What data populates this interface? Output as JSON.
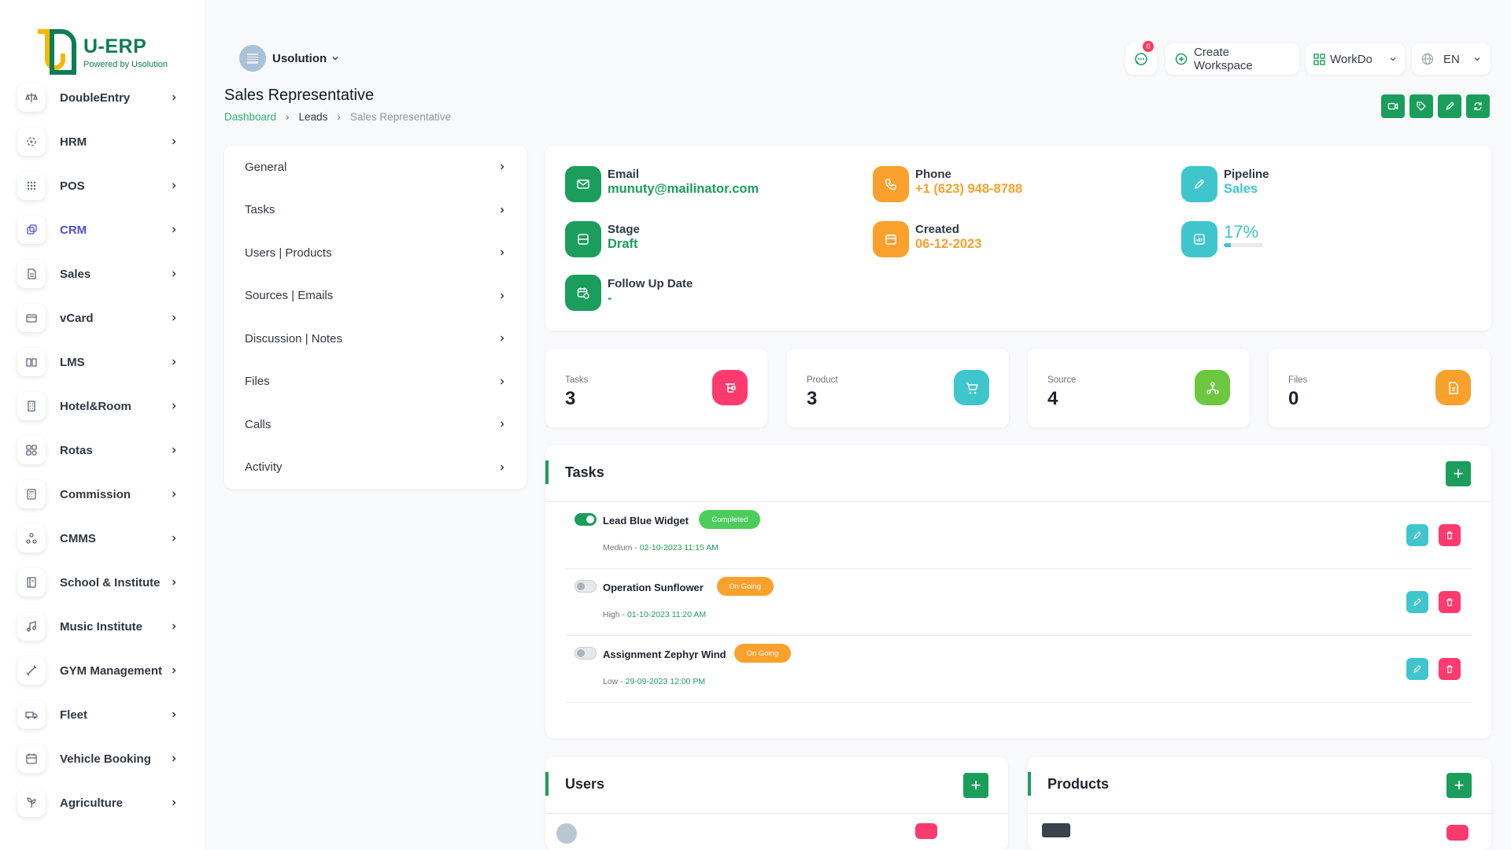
{
  "logo": {
    "name": "U-ERP",
    "sub": "Powered by Usolution"
  },
  "sidebar": {
    "items": [
      {
        "label": "DoubleEntry",
        "icon": "scale-icon"
      },
      {
        "label": "HRM",
        "icon": "hrm-icon"
      },
      {
        "label": "POS",
        "icon": "grid-icon"
      },
      {
        "label": "CRM",
        "icon": "crm-icon",
        "active": true
      },
      {
        "label": "Sales",
        "icon": "document-icon"
      },
      {
        "label": "vCard",
        "icon": "card-icon"
      },
      {
        "label": "LMS",
        "icon": "book-icon"
      },
      {
        "label": "Hotel&Room",
        "icon": "building-icon"
      },
      {
        "label": "Rotas",
        "icon": "apps-icon"
      },
      {
        "label": "Commission",
        "icon": "calculator-icon"
      },
      {
        "label": "CMMS",
        "icon": "nodes-icon"
      },
      {
        "label": "School & Institute",
        "icon": "school-icon"
      },
      {
        "label": "Music Institute",
        "icon": "music-icon"
      },
      {
        "label": "GYM Management",
        "icon": "dumbbell-icon"
      },
      {
        "label": "Fleet",
        "icon": "truck-icon"
      },
      {
        "label": "Vehicle Booking",
        "icon": "calendar-icon"
      },
      {
        "label": "Agriculture",
        "icon": "plant-icon"
      }
    ]
  },
  "header": {
    "workspace": "Usolution",
    "notifications_count": "0",
    "create_workspace": "Create Workspace",
    "workdo": "WorkDo",
    "language": "EN"
  },
  "page": {
    "title": "Sales Representative",
    "breadcrumb": [
      "Dashboard",
      "Leads",
      "Sales Representative"
    ]
  },
  "menu": [
    "General",
    "Tasks",
    "Users | Products",
    "Sources | Emails",
    "Discussion | Notes",
    "Files",
    "Calls",
    "Activity"
  ],
  "info": {
    "email_label": "Email",
    "email": "munuty@mailinator.com",
    "phone_label": "Phone",
    "phone": "+1 (623) 948-8788",
    "pipeline_label": "Pipeline",
    "pipeline": "Sales",
    "stage_label": "Stage",
    "stage": "Draft",
    "created_label": "Created",
    "created": "06-12-2023",
    "progress_label": "17%",
    "progress": 17,
    "followup_label": "Follow Up Date",
    "followup": "-"
  },
  "stats": [
    {
      "label": "Tasks",
      "value": "3",
      "color": "#ff3a6e"
    },
    {
      "label": "Product",
      "value": "3",
      "color": "#3ec6cc"
    },
    {
      "label": "Source",
      "value": "4",
      "color": "#6bc83f"
    },
    {
      "label": "Files",
      "value": "0",
      "color": "#f9a12c"
    }
  ],
  "tasks": {
    "title": "Tasks",
    "add": "+",
    "items": [
      {
        "name": "Lead Blue Widget",
        "status": "Completed",
        "priority": "Medium",
        "date": "02-10-2023 11:15 AM",
        "done": true
      },
      {
        "name": "Operation Sunflower",
        "status": "On Going",
        "priority": "High",
        "date": "01-10-2023 11:20 AM",
        "done": false
      },
      {
        "name": "Assignment Zephyr Wind",
        "status": "On Going",
        "priority": "Low",
        "date": "29-09-2023 12:00 PM",
        "done": false
      }
    ]
  },
  "users": {
    "title": "Users",
    "add": "+"
  },
  "products": {
    "title": "Products",
    "add": "+"
  },
  "colors": {
    "primary": "#1b9e5b",
    "orange": "#f9a12c",
    "teal": "#3ec6cc",
    "red": "#ff3a6e",
    "active_nav": "#4a4fd1"
  }
}
